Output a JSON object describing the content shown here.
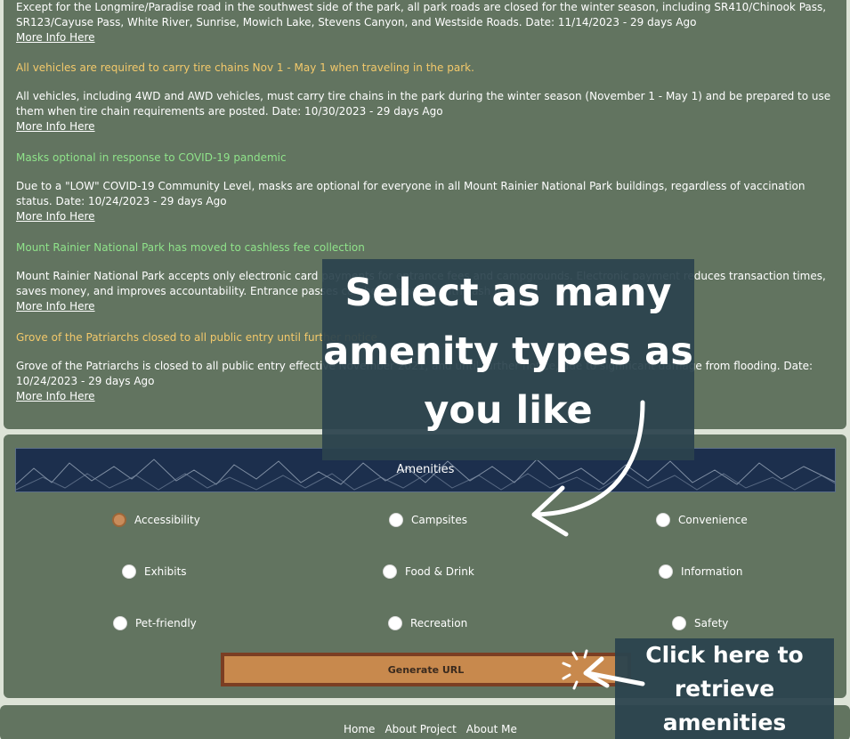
{
  "alerts": [
    {
      "title": "",
      "title_color": "none",
      "body": "Except for the Longmire/Paradise road in the southwest side of the park, all park roads are closed for the winter season, including SR410/Chinook Pass, SR123/Cayuse Pass, White River, Sunrise, Mowich Lake, Stevens Canyon, and Westside Roads. Date: 11/14/2023 - 29 days Ago",
      "link": "More Info Here"
    },
    {
      "title": "All vehicles are required to carry tire chains Nov 1 - May 1 when traveling in the park.",
      "title_color": "#f3c96b",
      "body": "All vehicles, including 4WD and AWD vehicles, must carry tire chains in the park during the winter season (November 1 - May 1) and be prepared to use them when tire chain requirements are posted. Date: 10/30/2023 - 29 days Ago",
      "link": "More Info Here"
    },
    {
      "title": "Masks optional in response to COVID-19 pandemic",
      "title_color": "#8fe38a",
      "body": "Due to a \"LOW\" COVID-19 Community Level, masks are optional for everyone in all Mount Rainier National Park buildings, regardless of vaccination status. Date: 10/24/2023 - 29 days Ago",
      "link": "More Info Here"
    },
    {
      "title": "Mount Rainier National Park has moved to cashless fee collection",
      "title_color": "#8fe38a",
      "body": "Mount Rainier National Park accepts only electronic card payments for entrance fees and campgrounds. Electronic payment reduces transaction times, saves money, and improves accountability. Entrance passes can be purchased with cash in",
      "link": "More Info Here"
    },
    {
      "title": "Grove of the Patriarchs closed to all public entry until further notice",
      "title_color": "#f3c96b",
      "body": "Grove of the Patriarchs is closed to all public entry effective November 2021, and until further notice, due to significant damage from flooding. Date: 10/24/2023 - 29 days Ago",
      "link": "More Info Here"
    }
  ],
  "amenities": {
    "title": "Amenities",
    "options": [
      {
        "label": "Accessibility",
        "checked": true
      },
      {
        "label": "Campsites",
        "checked": false
      },
      {
        "label": "Convenience",
        "checked": false
      },
      {
        "label": "Exhibits",
        "checked": false
      },
      {
        "label": "Food & Drink",
        "checked": false
      },
      {
        "label": "Information",
        "checked": false
      },
      {
        "label": "Pet-friendly",
        "checked": false
      },
      {
        "label": "Recreation",
        "checked": false
      },
      {
        "label": "Safety",
        "checked": false
      }
    ],
    "button_label": "Generate URL"
  },
  "footer": {
    "links": [
      "Home",
      "About Project",
      "About Me"
    ]
  },
  "overlays": {
    "main_lines": [
      "Select as many",
      "amenity types as",
      "you like"
    ],
    "click_lines": [
      "Click here to",
      "retrieve",
      "amenities"
    ]
  },
  "colors": {
    "panel": "#627460",
    "page_bg": "#dde3d7",
    "banner": "#1c2f4d",
    "button": "#c8894d",
    "button_border": "#7b3e23",
    "overlay": "#2b434e",
    "warning_title": "#f3c96b",
    "info_title": "#8fe38a"
  }
}
